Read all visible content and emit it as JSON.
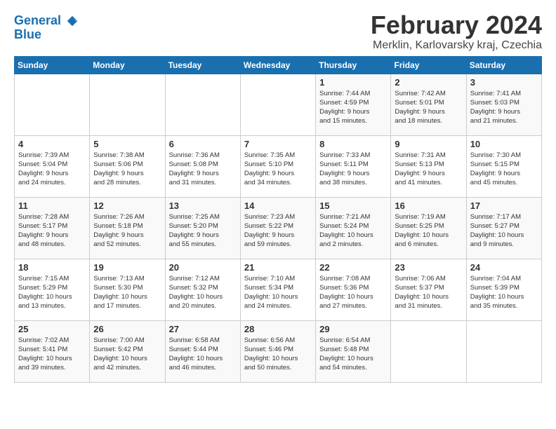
{
  "logo": {
    "line1": "General",
    "line2": "Blue"
  },
  "title": "February 2024",
  "location": "Merklin, Karlovarsky kraj, Czechia",
  "days_of_week": [
    "Sunday",
    "Monday",
    "Tuesday",
    "Wednesday",
    "Thursday",
    "Friday",
    "Saturday"
  ],
  "weeks": [
    [
      {
        "day": "",
        "info": ""
      },
      {
        "day": "",
        "info": ""
      },
      {
        "day": "",
        "info": ""
      },
      {
        "day": "",
        "info": ""
      },
      {
        "day": "1",
        "info": "Sunrise: 7:44 AM\nSunset: 4:59 PM\nDaylight: 9 hours\nand 15 minutes."
      },
      {
        "day": "2",
        "info": "Sunrise: 7:42 AM\nSunset: 5:01 PM\nDaylight: 9 hours\nand 18 minutes."
      },
      {
        "day": "3",
        "info": "Sunrise: 7:41 AM\nSunset: 5:03 PM\nDaylight: 9 hours\nand 21 minutes."
      }
    ],
    [
      {
        "day": "4",
        "info": "Sunrise: 7:39 AM\nSunset: 5:04 PM\nDaylight: 9 hours\nand 24 minutes."
      },
      {
        "day": "5",
        "info": "Sunrise: 7:38 AM\nSunset: 5:06 PM\nDaylight: 9 hours\nand 28 minutes."
      },
      {
        "day": "6",
        "info": "Sunrise: 7:36 AM\nSunset: 5:08 PM\nDaylight: 9 hours\nand 31 minutes."
      },
      {
        "day": "7",
        "info": "Sunrise: 7:35 AM\nSunset: 5:10 PM\nDaylight: 9 hours\nand 34 minutes."
      },
      {
        "day": "8",
        "info": "Sunrise: 7:33 AM\nSunset: 5:11 PM\nDaylight: 9 hours\nand 38 minutes."
      },
      {
        "day": "9",
        "info": "Sunrise: 7:31 AM\nSunset: 5:13 PM\nDaylight: 9 hours\nand 41 minutes."
      },
      {
        "day": "10",
        "info": "Sunrise: 7:30 AM\nSunset: 5:15 PM\nDaylight: 9 hours\nand 45 minutes."
      }
    ],
    [
      {
        "day": "11",
        "info": "Sunrise: 7:28 AM\nSunset: 5:17 PM\nDaylight: 9 hours\nand 48 minutes."
      },
      {
        "day": "12",
        "info": "Sunrise: 7:26 AM\nSunset: 5:18 PM\nDaylight: 9 hours\nand 52 minutes."
      },
      {
        "day": "13",
        "info": "Sunrise: 7:25 AM\nSunset: 5:20 PM\nDaylight: 9 hours\nand 55 minutes."
      },
      {
        "day": "14",
        "info": "Sunrise: 7:23 AM\nSunset: 5:22 PM\nDaylight: 9 hours\nand 59 minutes."
      },
      {
        "day": "15",
        "info": "Sunrise: 7:21 AM\nSunset: 5:24 PM\nDaylight: 10 hours\nand 2 minutes."
      },
      {
        "day": "16",
        "info": "Sunrise: 7:19 AM\nSunset: 5:25 PM\nDaylight: 10 hours\nand 6 minutes."
      },
      {
        "day": "17",
        "info": "Sunrise: 7:17 AM\nSunset: 5:27 PM\nDaylight: 10 hours\nand 9 minutes."
      }
    ],
    [
      {
        "day": "18",
        "info": "Sunrise: 7:15 AM\nSunset: 5:29 PM\nDaylight: 10 hours\nand 13 minutes."
      },
      {
        "day": "19",
        "info": "Sunrise: 7:13 AM\nSunset: 5:30 PM\nDaylight: 10 hours\nand 17 minutes."
      },
      {
        "day": "20",
        "info": "Sunrise: 7:12 AM\nSunset: 5:32 PM\nDaylight: 10 hours\nand 20 minutes."
      },
      {
        "day": "21",
        "info": "Sunrise: 7:10 AM\nSunset: 5:34 PM\nDaylight: 10 hours\nand 24 minutes."
      },
      {
        "day": "22",
        "info": "Sunrise: 7:08 AM\nSunset: 5:36 PM\nDaylight: 10 hours\nand 27 minutes."
      },
      {
        "day": "23",
        "info": "Sunrise: 7:06 AM\nSunset: 5:37 PM\nDaylight: 10 hours\nand 31 minutes."
      },
      {
        "day": "24",
        "info": "Sunrise: 7:04 AM\nSunset: 5:39 PM\nDaylight: 10 hours\nand 35 minutes."
      }
    ],
    [
      {
        "day": "25",
        "info": "Sunrise: 7:02 AM\nSunset: 5:41 PM\nDaylight: 10 hours\nand 39 minutes."
      },
      {
        "day": "26",
        "info": "Sunrise: 7:00 AM\nSunset: 5:42 PM\nDaylight: 10 hours\nand 42 minutes."
      },
      {
        "day": "27",
        "info": "Sunrise: 6:58 AM\nSunset: 5:44 PM\nDaylight: 10 hours\nand 46 minutes."
      },
      {
        "day": "28",
        "info": "Sunrise: 6:56 AM\nSunset: 5:46 PM\nDaylight: 10 hours\nand 50 minutes."
      },
      {
        "day": "29",
        "info": "Sunrise: 6:54 AM\nSunset: 5:48 PM\nDaylight: 10 hours\nand 54 minutes."
      },
      {
        "day": "",
        "info": ""
      },
      {
        "day": "",
        "info": ""
      }
    ]
  ]
}
